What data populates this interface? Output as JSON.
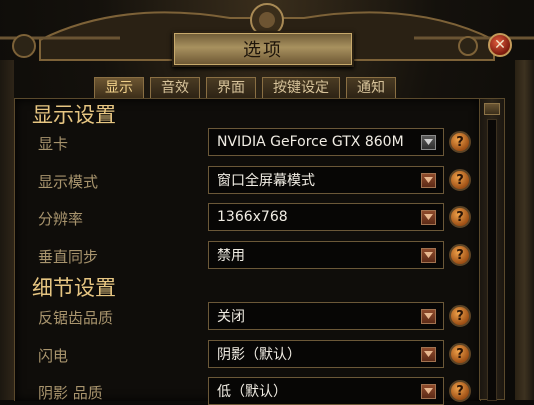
{
  "window": {
    "title": "选项",
    "close_glyph": "✕"
  },
  "tabs": [
    {
      "label": "显示",
      "active": true
    },
    {
      "label": "音效",
      "active": false
    },
    {
      "label": "界面",
      "active": false
    },
    {
      "label": "按键设定",
      "active": false
    },
    {
      "label": "通知",
      "active": false
    }
  ],
  "sections": {
    "display": {
      "title": "显示设置",
      "rows": [
        {
          "label": "显卡",
          "value": "NVIDIA GeForce GTX 860M"
        },
        {
          "label": "显示模式",
          "value": "窗口全屏幕模式"
        },
        {
          "label": "分辨率",
          "value": "1366x768"
        },
        {
          "label": "垂直同步",
          "value": "禁用"
        }
      ]
    },
    "detail": {
      "title": "细节设置",
      "rows": [
        {
          "label": "反锯齿品质",
          "value": "关闭"
        },
        {
          "label": "闪电",
          "value": "阴影（默认）"
        },
        {
          "label": "阴影 品质",
          "value": "低（默认）"
        }
      ]
    }
  },
  "help_glyph": "?",
  "colors": {
    "accent_gold": "#e7c682",
    "label": "#a8946d",
    "help_orange": "#f0a24a",
    "dropdown_arrow": "#8f4b2c"
  },
  "icons": {
    "close": "close-icon",
    "help": "help-icon",
    "dropdown": "dropdown-arrow-icon",
    "scroll_up": "scroll-up-icon"
  }
}
